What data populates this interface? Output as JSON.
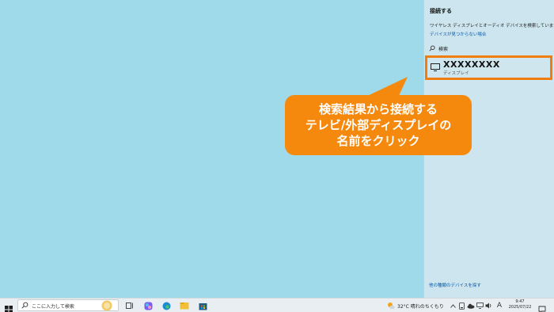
{
  "panel": {
    "title": "接続する",
    "status": "ワイヤレス ディスプレイとオーディオ デバイスを検索しています",
    "help_link": "デバイスが見つからない場合",
    "search_label": "検索",
    "device": {
      "name": "XXXXXXXX",
      "type": "ディスプレイ"
    },
    "other_devices_link": "他の種類のデバイスを探す"
  },
  "callout": {
    "lines": [
      "検索結果から接続する",
      "テレビ/外部ディスプレイの",
      "名前をクリック"
    ]
  },
  "taskbar": {
    "search_placeholder": "ここに入力して検索",
    "weather": "32°C 晴れのちくもり",
    "ime": "A",
    "time": "9:47",
    "date": "2025/07/22"
  },
  "colors": {
    "desktop": "#9fdaea",
    "panel": "#cde5ee",
    "accent_orange": "#f5890e",
    "link": "#0a5aa8"
  }
}
